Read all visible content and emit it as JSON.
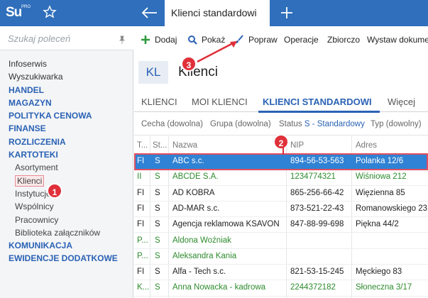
{
  "topbar": {
    "logo_text": "Su",
    "logo_sup": "PRO",
    "active_tab": "Klienci standardowi",
    "color": "#2f6fbb"
  },
  "sidebar": {
    "search_placeholder": "Szukaj poleceń",
    "items": [
      {
        "label": "Infoserwis",
        "kind": "plain"
      },
      {
        "label": "Wyszukiwarka",
        "kind": "plain"
      },
      {
        "label": "HANDEL",
        "kind": "head"
      },
      {
        "label": "MAGAZYN",
        "kind": "head"
      },
      {
        "label": "POLITYKA CENOWA",
        "kind": "head"
      },
      {
        "label": "FINANSE",
        "kind": "head"
      },
      {
        "label": "ROZLICZENIA",
        "kind": "head"
      },
      {
        "label": "KARTOTEKI",
        "kind": "head"
      },
      {
        "label": "Asortyment",
        "kind": "sub"
      },
      {
        "label": "Klienci",
        "kind": "sub sel"
      },
      {
        "label": "Instytucje",
        "kind": "sub"
      },
      {
        "label": "Wspólnicy",
        "kind": "sub"
      },
      {
        "label": "Pracownicy",
        "kind": "sub"
      },
      {
        "label": "Biblioteka załączników",
        "kind": "sub"
      },
      {
        "label": "KOMUNIKACJA",
        "kind": "head"
      },
      {
        "label": "EWIDENCJE DODATKOWE",
        "kind": "head"
      }
    ]
  },
  "toolbar": {
    "add": "Dodaj",
    "show": "Pokaż",
    "edit": "Popraw",
    "operations": "Operacje",
    "bulk": "Zbiorczo",
    "issue": "Wystaw dokume"
  },
  "header": {
    "badge": "KL",
    "title": "Klienci"
  },
  "tabs": [
    "KLIENCI",
    "MOI KLIENCI",
    "KLIENCI STANDARDOWI",
    "Więcej"
  ],
  "filters": {
    "category": "Cecha (dowolna)",
    "group": "Grupa (dowolna)",
    "status_label": "Status",
    "status_value": "S - Standardowy",
    "type": "Typ (dowolny)"
  },
  "grid": {
    "columns": [
      "T...",
      "St...",
      "Nazwa",
      "NIP",
      "Adres"
    ],
    "rows": [
      {
        "t": "FI",
        "s": "S",
        "name": "ABC s.c.",
        "nip": "894-56-53-563",
        "addr": "Polanka  12/6",
        "green": false,
        "selected": true
      },
      {
        "t": "II",
        "s": "S",
        "name": "ABCDE S.A.",
        "nip": "1234774321",
        "addr": "Wiśniowa 212",
        "green": true,
        "selected": false
      },
      {
        "t": "FI",
        "s": "S",
        "name": "AD KOBRA",
        "nip": "865-256-66-42",
        "addr": "Więzienna  85",
        "green": false,
        "selected": false
      },
      {
        "t": "FI",
        "s": "S",
        "name": "AD-MAR s.c.",
        "nip": "873-521-22-43",
        "addr": "Romanowskiego 23",
        "green": false,
        "selected": false
      },
      {
        "t": "FI",
        "s": "S",
        "name": "Agencja reklamowa KSAVON",
        "nip": "847-88-99-698",
        "addr": "Piękna  44/2",
        "green": false,
        "selected": false
      },
      {
        "t": "P...",
        "s": "S",
        "name": "Aldona Woźniak",
        "nip": "",
        "addr": "",
        "green": true,
        "selected": false
      },
      {
        "t": "P...",
        "s": "S",
        "name": "Aleksandra Kania",
        "nip": "",
        "addr": "",
        "green": true,
        "selected": false
      },
      {
        "t": "FI",
        "s": "S",
        "name": "Alfa - Tech s.c.",
        "nip": "821-53-15-245",
        "addr": "Męckiego  83",
        "green": false,
        "selected": false
      },
      {
        "t": "K...",
        "s": "S",
        "name": "Anna Nowacka - kadrowa",
        "nip": "2244372182",
        "addr": "Słoneczna 3/17",
        "green": true,
        "selected": false
      }
    ]
  },
  "callouts": [
    "1",
    "2",
    "3"
  ]
}
